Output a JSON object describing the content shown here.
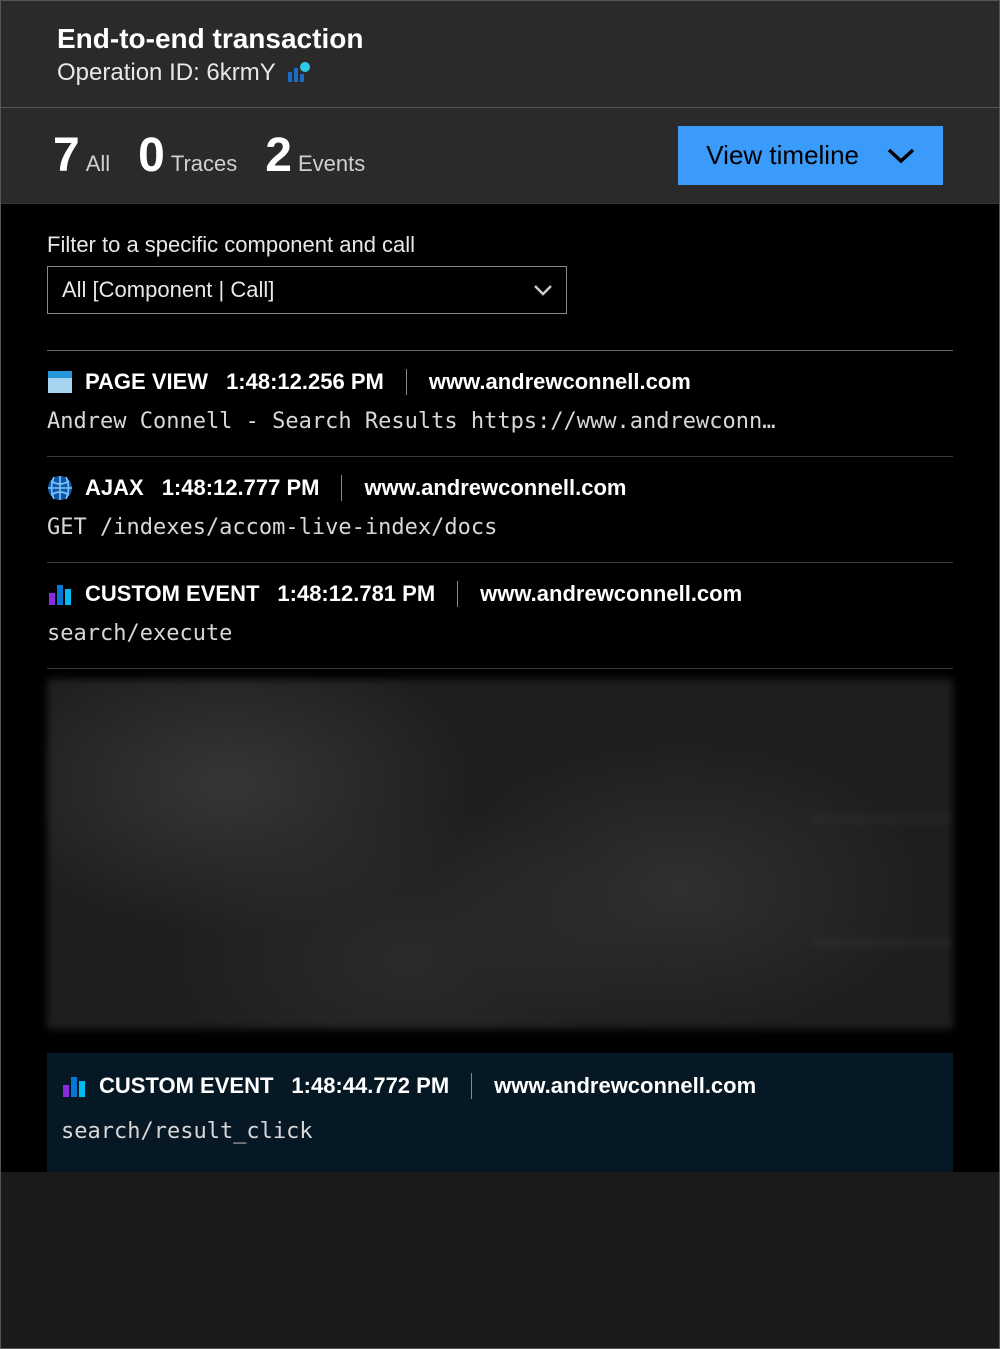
{
  "header": {
    "title": "End-to-end transaction",
    "operation_label": "Operation ID: 6krmY"
  },
  "stats": {
    "all_count": "7",
    "all_label": "All",
    "traces_count": "0",
    "traces_label": "Traces",
    "events_count": "2",
    "events_label": "Events",
    "view_timeline_label": "View timeline"
  },
  "filter": {
    "label": "Filter to a specific component and call",
    "selected": "All [Component | Call]"
  },
  "events": [
    {
      "icon": "page-view",
      "type": "PAGE VIEW",
      "time": "1:48:12.256 PM",
      "host": "www.andrewconnell.com",
      "detail": "Andrew Connell - Search Results https://www.andrewconn…"
    },
    {
      "icon": "globe",
      "type": "AJAX",
      "time": "1:48:12.777 PM",
      "host": "www.andrewconnell.com",
      "detail": "GET /indexes/accom-live-index/docs"
    },
    {
      "icon": "bar",
      "type": "CUSTOM EVENT",
      "time": "1:48:12.781 PM",
      "host": "www.andrewconnell.com",
      "detail": "search/execute"
    }
  ],
  "selected_event": {
    "icon": "bar",
    "type": "CUSTOM EVENT",
    "time": "1:48:44.772 PM",
    "host": "www.andrewconnell.com",
    "detail": "search/result_click"
  }
}
